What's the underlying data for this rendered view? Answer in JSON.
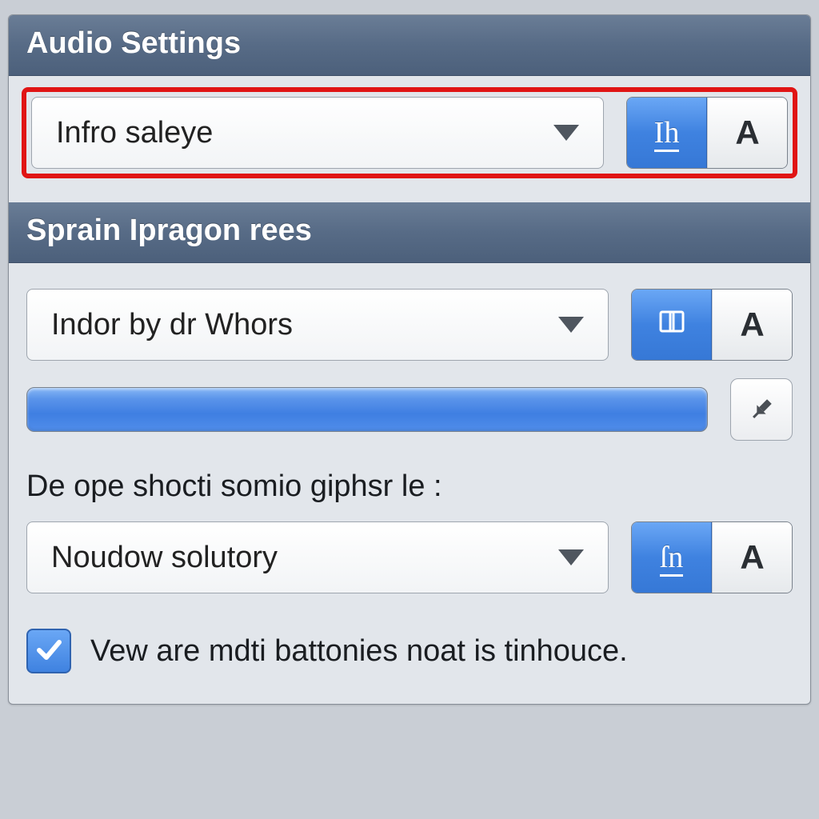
{
  "colors": {
    "accent_blue": "#3f82e0",
    "highlight_red": "#e01515",
    "header_gradient_top": "#6a7d96",
    "header_gradient_bottom": "#4c607b"
  },
  "section1": {
    "title": "Audio Settings",
    "dropdown": {
      "selected": "Infro saleye",
      "highlighted": true
    },
    "segmented": {
      "active_label": "Ih",
      "inactive_label": "A"
    }
  },
  "section2": {
    "title": "Sprain Ipragon rees",
    "dropdown1": {
      "selected": "Indor by dr Whors"
    },
    "segmented1": {
      "active_icon": "panel-icon",
      "inactive_label": "A"
    },
    "progress": {
      "value_percent": 100
    },
    "pin_button_icon": "pin-icon",
    "field_label": "De ope shocti somio giphsr le :",
    "dropdown2": {
      "selected": "Noudow solutory"
    },
    "segmented2": {
      "active_label": "ſn",
      "inactive_label": "A"
    },
    "checkbox": {
      "checked": true,
      "label": "Vew are mdti battonies noat is tinhouce."
    }
  }
}
